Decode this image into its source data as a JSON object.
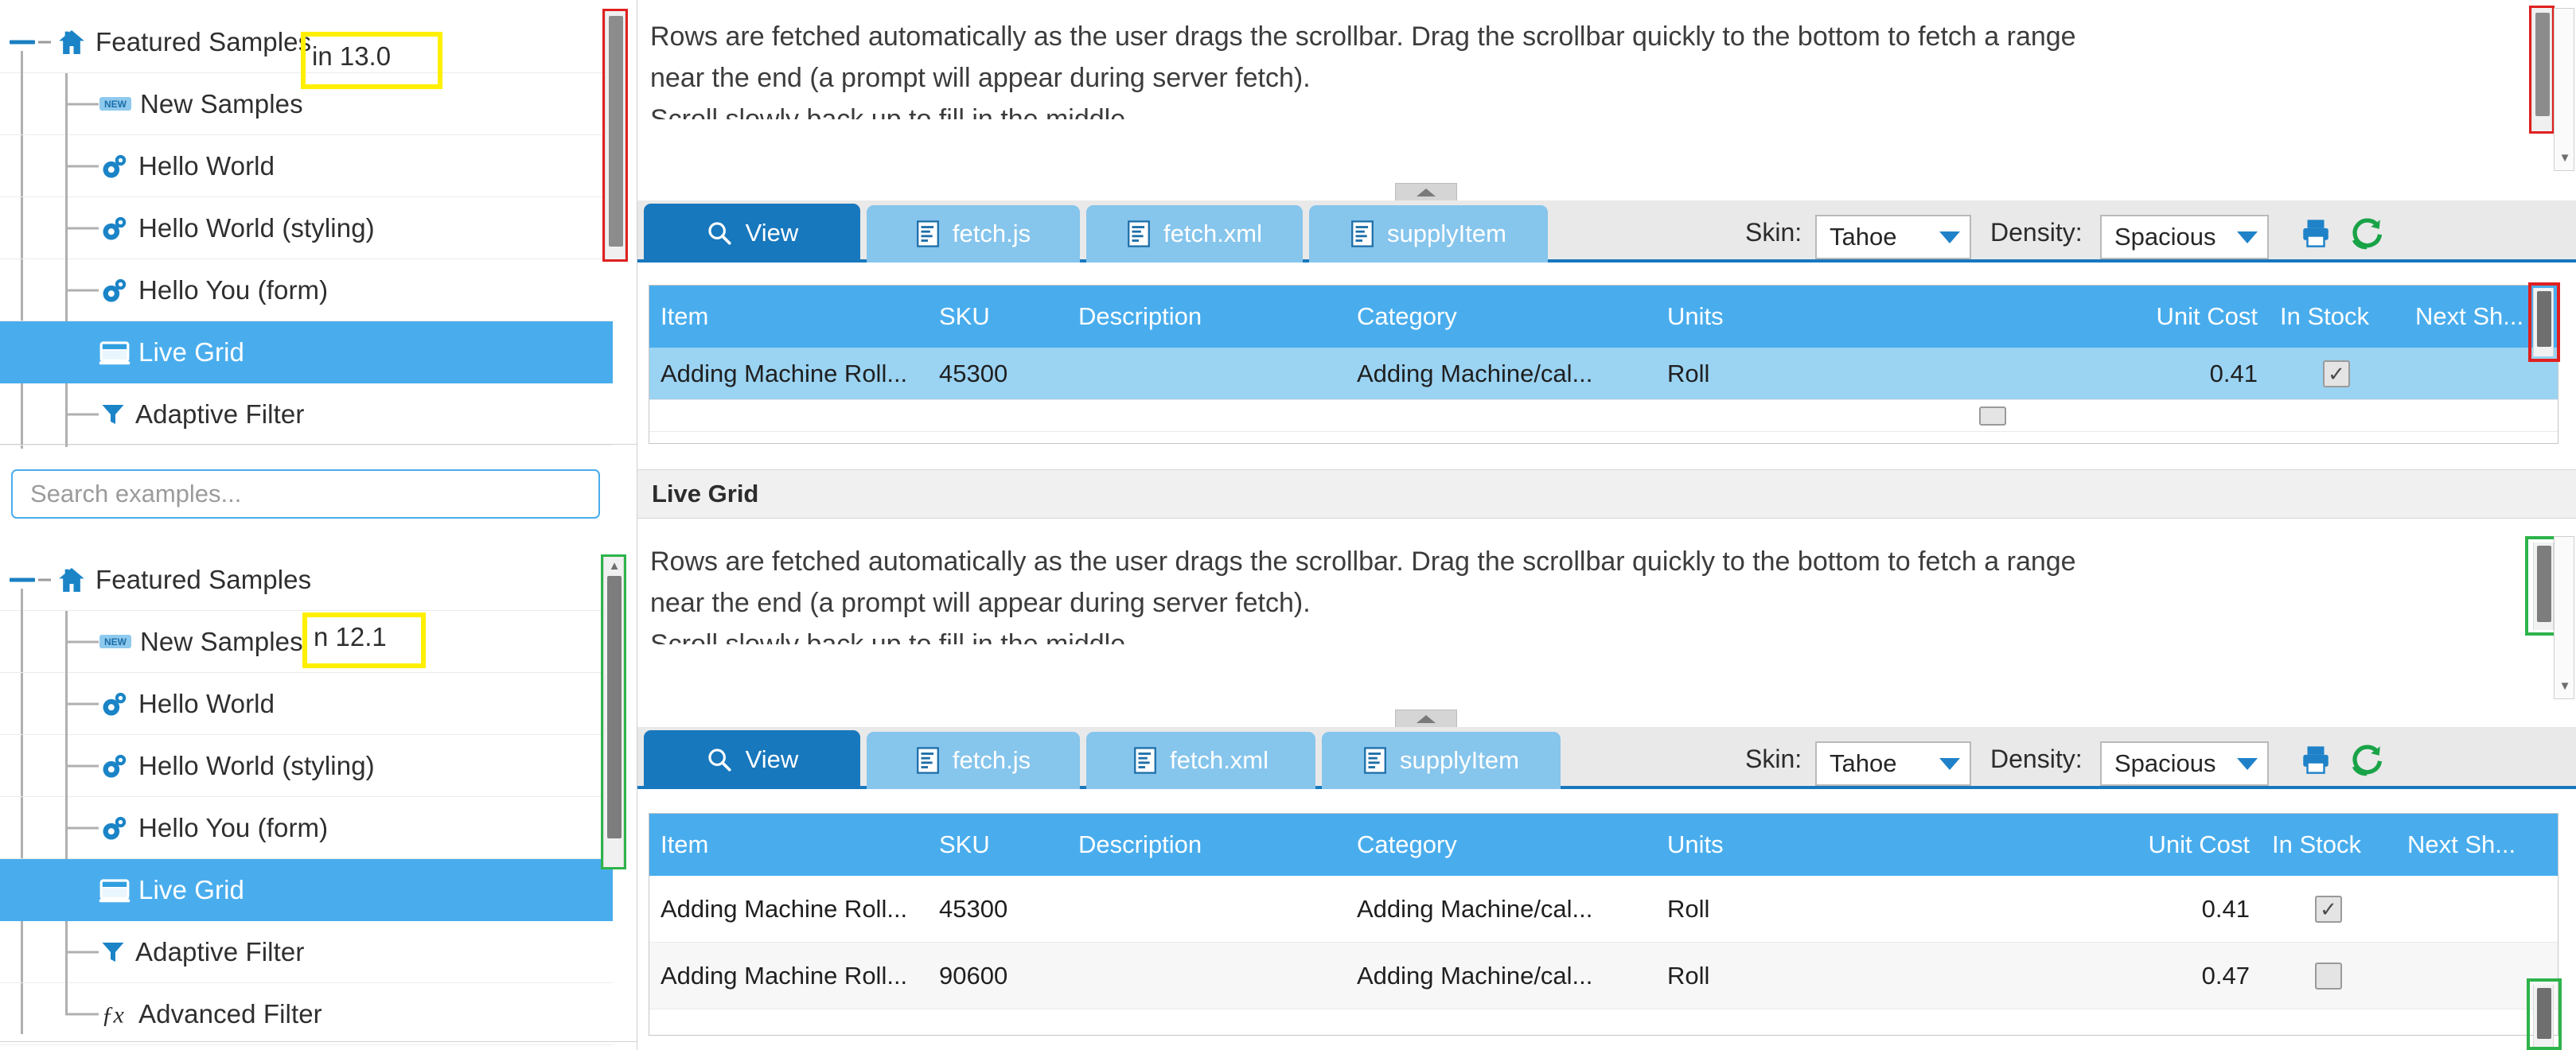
{
  "meta": {
    "accent_blue": "#1878bd",
    "header_blue": "#49aded",
    "highlight_yellow": "#ffef00",
    "callout_red": "#e02020",
    "callout_green": "#2db34a"
  },
  "left": {
    "top_tree": {
      "version_badge": "in 13.0",
      "items": [
        {
          "label": "Featured Samples",
          "icon": "home-icon",
          "depth": 0,
          "selected": false
        },
        {
          "label": "New Samples",
          "icon": "new-badge-icon",
          "depth": 1,
          "selected": false
        },
        {
          "label": "Hello World",
          "icon": "gears-icon",
          "depth": 1,
          "selected": false
        },
        {
          "label": "Hello World (styling)",
          "icon": "gears-icon",
          "depth": 1,
          "selected": false
        },
        {
          "label": "Hello You (form)",
          "icon": "gears-icon",
          "depth": 1,
          "selected": false
        },
        {
          "label": "Live Grid",
          "icon": "grid-icon",
          "depth": 1,
          "selected": true
        },
        {
          "label": "Adaptive Filter",
          "icon": "funnel-icon",
          "depth": 1,
          "selected": false
        }
      ]
    },
    "search": {
      "placeholder": "Search examples...",
      "value": ""
    },
    "bottom_tree": {
      "version_badge": "n 12.1",
      "items": [
        {
          "label": "Featured Samples",
          "icon": "home-icon",
          "depth": 0,
          "selected": false
        },
        {
          "label": "New Samples",
          "icon": "new-badge-icon",
          "depth": 1,
          "selected": false
        },
        {
          "label": "Hello World",
          "icon": "gears-icon",
          "depth": 1,
          "selected": false
        },
        {
          "label": "Hello World (styling)",
          "icon": "gears-icon",
          "depth": 1,
          "selected": false
        },
        {
          "label": "Hello You (form)",
          "icon": "gears-icon",
          "depth": 1,
          "selected": false
        },
        {
          "label": "Live Grid",
          "icon": "grid-icon",
          "depth": 1,
          "selected": true
        },
        {
          "label": "Adaptive Filter",
          "icon": "funnel-icon",
          "depth": 1,
          "selected": false
        },
        {
          "label": "Advanced Filter",
          "icon": "fx-icon",
          "depth": 1,
          "selected": false
        }
      ]
    }
  },
  "right": {
    "top_example": {
      "description_line1": "Rows are fetched automatically as the user drags the scrollbar. Drag the scrollbar quickly to the bottom to fetch a range",
      "description_line2": "near the end (a prompt will appear during server fetch).",
      "description_line3": "Scroll slowly back up to fill in the middle.",
      "tabs": [
        {
          "label": "View",
          "icon": "magnifier-icon",
          "active": true
        },
        {
          "label": "fetch.js",
          "icon": "file-code-icon",
          "active": false
        },
        {
          "label": "fetch.xml",
          "icon": "file-code-icon",
          "active": false
        },
        {
          "label": "supplyItem",
          "icon": "file-code-icon",
          "active": false
        }
      ],
      "skin_label": "Skin:",
      "skin_value": "Tahoe",
      "density_label": "Density:",
      "density_value": "Spacious",
      "print_icon": "printer-icon",
      "refresh_icon": "refresh-icon",
      "grid": {
        "columns": [
          "Item",
          "SKU",
          "Description",
          "Category",
          "Units",
          "Unit Cost",
          "In Stock",
          "Next Sh..."
        ],
        "rows": [
          {
            "item": "Adding Machine Roll...",
            "sku": "45300",
            "description": "",
            "category": "Adding Machine/cal...",
            "units": "Roll",
            "unit_cost": "0.41",
            "in_stock": true,
            "next_ship": "",
            "selected": true
          }
        ]
      }
    },
    "divider_title": "Live Grid",
    "bottom_example": {
      "description_line1": "Rows are fetched automatically as the user drags the scrollbar. Drag the scrollbar quickly to the bottom to fetch a range",
      "description_line2": "near the end (a prompt will appear during server fetch).",
      "description_line3": "Scroll slowly back up to fill in the middle.",
      "tabs": [
        {
          "label": "View",
          "icon": "magnifier-icon",
          "active": true
        },
        {
          "label": "fetch.js",
          "icon": "file-code-icon",
          "active": false
        },
        {
          "label": "fetch.xml",
          "icon": "file-code-icon",
          "active": false
        },
        {
          "label": "supplyItem",
          "icon": "file-code-icon",
          "active": false
        }
      ],
      "skin_label": "Skin:",
      "skin_value": "Tahoe",
      "density_label": "Density:",
      "density_value": "Spacious",
      "print_icon": "printer-icon",
      "refresh_icon": "refresh-icon",
      "grid": {
        "columns": [
          "Item",
          "SKU",
          "Description",
          "Category",
          "Units",
          "Unit Cost",
          "In Stock",
          "Next Sh..."
        ],
        "rows": [
          {
            "item": "Adding Machine Roll...",
            "sku": "45300",
            "description": "",
            "category": "Adding Machine/cal...",
            "units": "Roll",
            "unit_cost": "0.41",
            "in_stock": true,
            "next_ship": "",
            "selected": false
          },
          {
            "item": "Adding Machine Roll...",
            "sku": "90600",
            "description": "",
            "category": "Adding Machine/cal...",
            "units": "Roll",
            "unit_cost": "0.47",
            "in_stock": false,
            "next_ship": "",
            "selected": false
          }
        ]
      }
    }
  }
}
